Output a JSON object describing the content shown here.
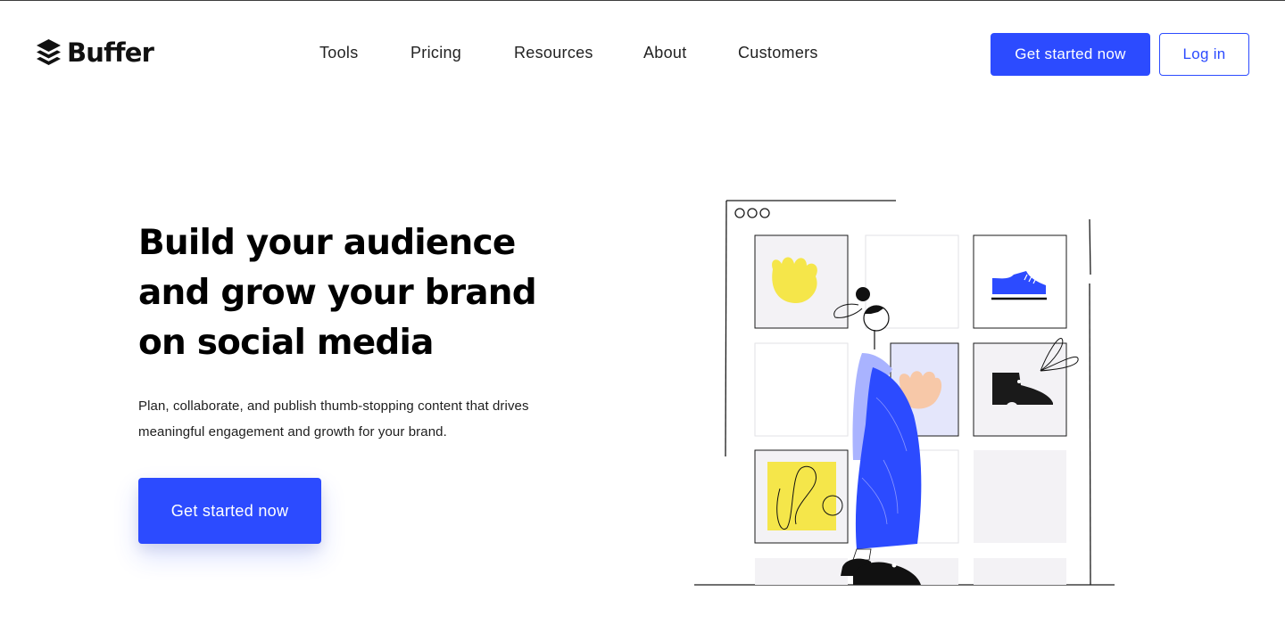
{
  "brand": {
    "name": "Buffer"
  },
  "nav": {
    "items": [
      {
        "label": "Tools"
      },
      {
        "label": "Pricing"
      },
      {
        "label": "Resources"
      },
      {
        "label": "About"
      },
      {
        "label": "Customers"
      }
    ]
  },
  "header_actions": {
    "primary_label": "Get started now",
    "login_label": "Log in"
  },
  "hero": {
    "title_lines": [
      "Build your audience",
      "and grow your brand",
      "on social media"
    ],
    "subtitle": "Plan, collaborate, and publish thumb-stopping content that drives meaningful engagement and growth for your brand.",
    "cta_label": "Get started now"
  },
  "colors": {
    "accent": "#2c4bff",
    "accent_light": "#a9b3ff",
    "yellow": "#f5e64a",
    "peach": "#f7c8a8",
    "ink": "#111111"
  },
  "illustration": {
    "icons": [
      "flower-icon",
      "sneaker-icon",
      "boot-icon",
      "abstract-art-icon",
      "person-figure"
    ]
  }
}
